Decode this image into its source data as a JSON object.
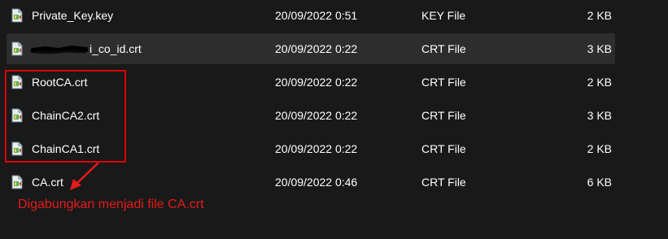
{
  "files": [
    {
      "name": "Private_Key.key",
      "date": "20/09/2022 0:51",
      "type": "KEY File",
      "size": "2 KB",
      "redacted": false,
      "selected": false
    },
    {
      "name": "i_co_id.crt",
      "date": "20/09/2022 0:22",
      "type": "CRT File",
      "size": "3 KB",
      "redacted": true,
      "selected": true
    },
    {
      "name": "RootCA.crt",
      "date": "20/09/2022 0:22",
      "type": "CRT File",
      "size": "2 KB",
      "redacted": false,
      "selected": false
    },
    {
      "name": "ChainCA2.crt",
      "date": "20/09/2022 0:22",
      "type": "CRT File",
      "size": "3 KB",
      "redacted": false,
      "selected": false
    },
    {
      "name": "ChainCA1.crt",
      "date": "20/09/2022 0:22",
      "type": "CRT File",
      "size": "2 KB",
      "redacted": false,
      "selected": false
    },
    {
      "name": "CA.crt",
      "date": "20/09/2022 0:46",
      "type": "CRT File",
      "size": "6 KB",
      "redacted": false,
      "selected": false
    }
  ],
  "annotation": {
    "text": "Digabungkan menjadi file CA.crt",
    "color": "#e51b1b"
  },
  "colors": {
    "background": "#191919",
    "selected_row": "#2d2d2d",
    "highlight": "#e00000"
  },
  "icons": {
    "file": "certificate-file-icon"
  }
}
